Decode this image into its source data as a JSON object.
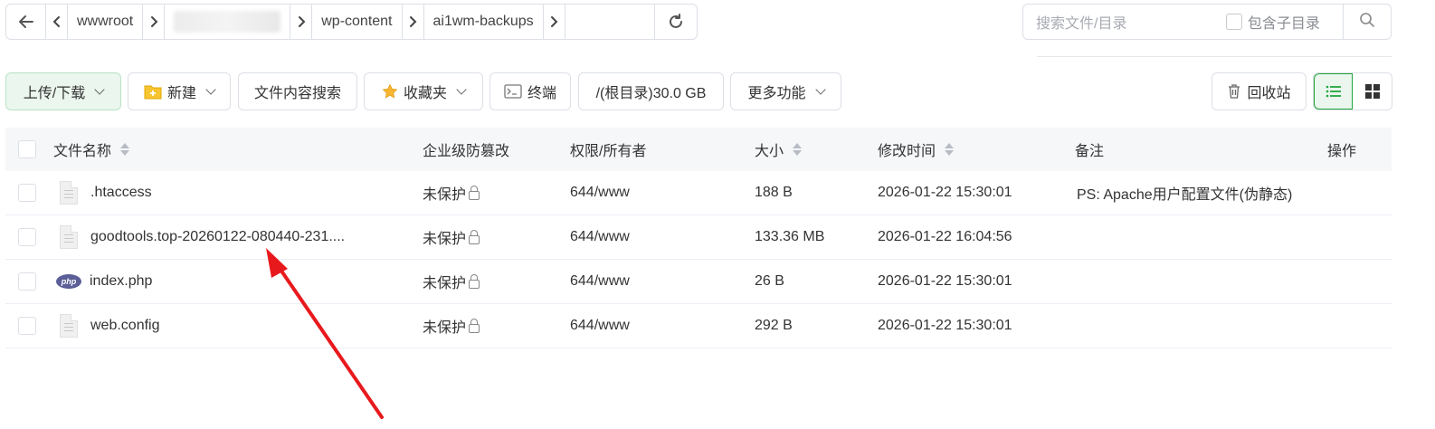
{
  "pathbar": {
    "segments": [
      "wwwroot",
      "wp-content",
      "ai1wm-backups"
    ]
  },
  "search": {
    "placeholder": "搜索文件/目录",
    "include_subdir_label": "包含子目录"
  },
  "toolbar": {
    "upload_download": "上传/下载",
    "new": "新建",
    "content_search": "文件内容搜索",
    "favorites": "收藏夹",
    "terminal": "终端",
    "disk": "/(根目录)30.0 GB",
    "more": "更多功能",
    "recycle": "回收站"
  },
  "table": {
    "headers": {
      "name": "文件名称",
      "tamper": "企业级防篡改",
      "perm": "权限/所有者",
      "size": "大小",
      "mtime": "修改时间",
      "note": "备注",
      "ops": "操作"
    },
    "rows": [
      {
        "name": ".htaccess",
        "icon": "text-file-icon",
        "tamper": "未保护",
        "perm": "644/www",
        "size": "188 B",
        "mtime": "2026-01-22 15:30:01",
        "note": "PS: Apache用户配置文件(伪静态)"
      },
      {
        "name": "goodtools.top-20260122-080440-231....",
        "icon": "text-file-icon",
        "tamper": "未保护",
        "perm": "644/www",
        "size": "133.36 MB",
        "mtime": "2026-01-22 16:04:56",
        "note": ""
      },
      {
        "name": "index.php",
        "icon": "php-icon",
        "tamper": "未保护",
        "perm": "644/www",
        "size": "26 B",
        "mtime": "2026-01-22 15:30:01",
        "note": ""
      },
      {
        "name": "web.config",
        "icon": "text-file-icon",
        "tamper": "未保护",
        "perm": "644/www",
        "size": "292 B",
        "mtime": "2026-01-22 15:30:01",
        "note": ""
      }
    ]
  },
  "colors": {
    "accent_green": "#20a53a",
    "annotation_arrow": "#e8191d"
  }
}
